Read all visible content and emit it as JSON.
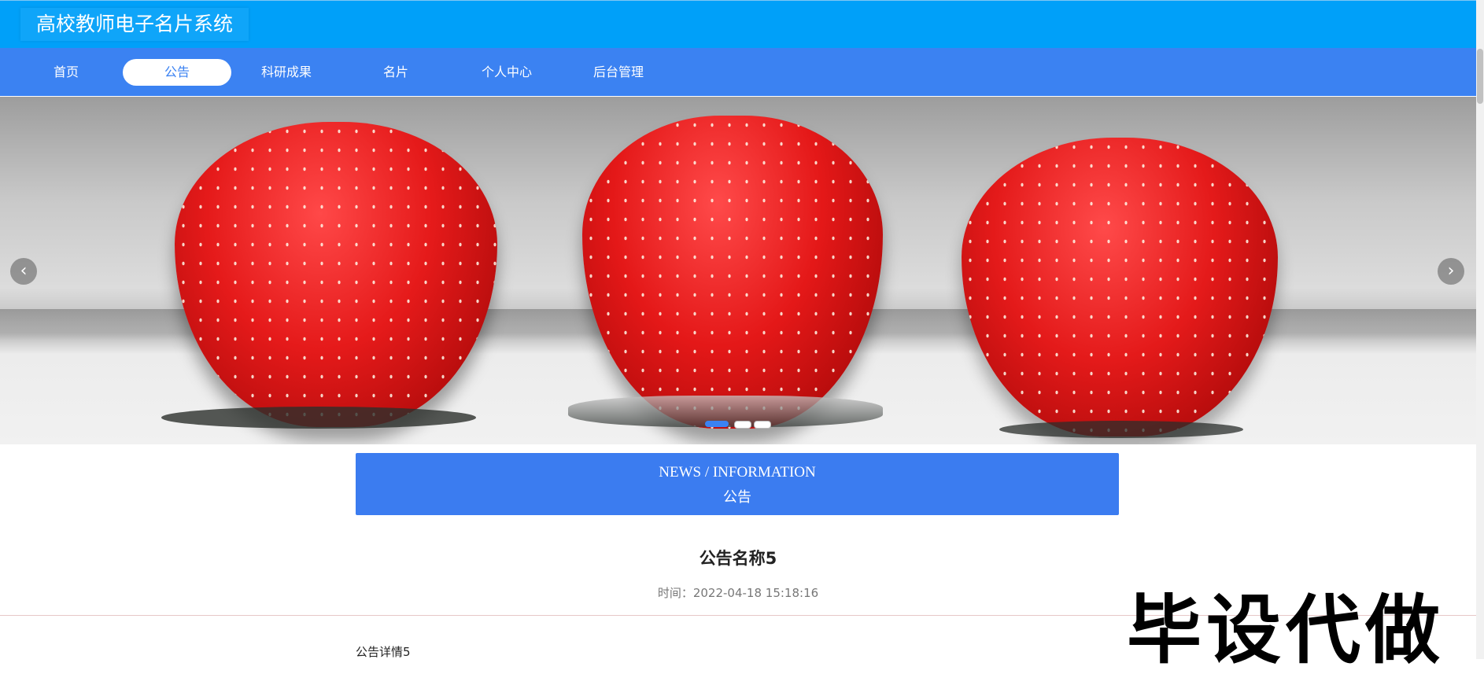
{
  "header": {
    "title": "高校教师电子名片系统"
  },
  "nav": {
    "items": [
      {
        "label": "首页",
        "active": false
      },
      {
        "label": "公告",
        "active": true
      },
      {
        "label": "科研成果",
        "active": false
      },
      {
        "label": "名片",
        "active": false
      },
      {
        "label": "个人中心",
        "active": false
      },
      {
        "label": "后台管理",
        "active": false
      }
    ]
  },
  "carousel": {
    "prev_icon": "chevron-left-icon",
    "next_icon": "chevron-right-icon",
    "prev_glyph": "‹",
    "next_glyph": "›",
    "slide_count": 3,
    "active_index": 0,
    "active_color": "#3b82f2",
    "image": "three strawberries"
  },
  "section": {
    "title_en": "NEWS / INFORMATION",
    "title_cn": "公告"
  },
  "article": {
    "title": "公告名称5",
    "time": "时间：2022-04-18 15:18:16",
    "body": "公告详情5"
  },
  "watermark": "毕设代做",
  "colors": {
    "topbar": "#00a0f9",
    "navbar": "#3b82f2",
    "section_head": "#3b7cf0"
  }
}
